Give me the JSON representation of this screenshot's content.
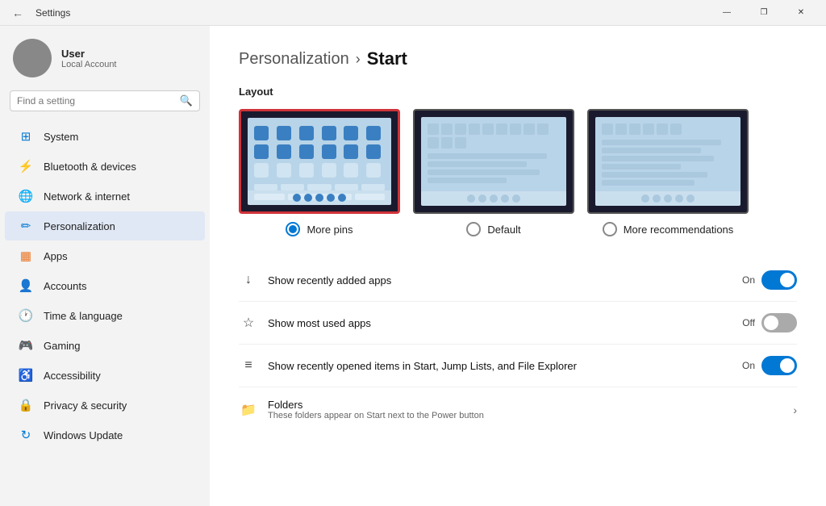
{
  "titlebar": {
    "title": "Settings",
    "minimize_label": "—",
    "maximize_label": "❐",
    "close_label": "✕"
  },
  "sidebar": {
    "search_placeholder": "Find a setting",
    "user": {
      "name": "User",
      "sub": "Local Account"
    },
    "nav_items": [
      {
        "id": "system",
        "label": "System",
        "icon": "⊞",
        "icon_class": "blue"
      },
      {
        "id": "bluetooth",
        "label": "Bluetooth & devices",
        "icon": "⚡",
        "icon_class": "teal"
      },
      {
        "id": "network",
        "label": "Network & internet",
        "icon": "🌐",
        "icon_class": "blue"
      },
      {
        "id": "personalization",
        "label": "Personalization",
        "icon": "✏",
        "icon_class": "blue",
        "active": true
      },
      {
        "id": "apps",
        "label": "Apps",
        "icon": "▦",
        "icon_class": "orange"
      },
      {
        "id": "accounts",
        "label": "Accounts",
        "icon": "👤",
        "icon_class": "blue"
      },
      {
        "id": "time",
        "label": "Time & language",
        "icon": "🕐",
        "icon_class": "purple"
      },
      {
        "id": "gaming",
        "label": "Gaming",
        "icon": "🎮",
        "icon_class": "yellow"
      },
      {
        "id": "accessibility",
        "label": "Accessibility",
        "icon": "♿",
        "icon_class": "darkblue"
      },
      {
        "id": "privacy",
        "label": "Privacy & security",
        "icon": "🔒",
        "icon_class": "green"
      },
      {
        "id": "windows-update",
        "label": "Windows Update",
        "icon": "↻",
        "icon_class": "blue"
      }
    ]
  },
  "content": {
    "breadcrumb_parent": "Personalization",
    "breadcrumb_sep": "›",
    "breadcrumb_current": "Start",
    "layout_label": "Layout",
    "layout_options": [
      {
        "id": "more-pins",
        "label": "More pins",
        "selected": true
      },
      {
        "id": "default",
        "label": "Default",
        "selected": false
      },
      {
        "id": "more-recs",
        "label": "More recommendations",
        "selected": false
      }
    ],
    "settings": [
      {
        "id": "recently-added",
        "title": "Show recently added apps",
        "subtitle": "",
        "toggle_state": "on",
        "toggle_label_on": "On",
        "toggle_label_off": "Off",
        "icon": "↓",
        "type": "toggle"
      },
      {
        "id": "most-used",
        "title": "Show most used apps",
        "subtitle": "",
        "toggle_state": "off",
        "toggle_label_on": "On",
        "toggle_label_off": "Off",
        "icon": "☆",
        "type": "toggle"
      },
      {
        "id": "recently-opened",
        "title": "Show recently opened items in Start, Jump Lists, and File Explorer",
        "subtitle": "",
        "toggle_state": "on",
        "toggle_label_on": "On",
        "toggle_label_off": "Off",
        "icon": "≡",
        "type": "toggle"
      },
      {
        "id": "folders",
        "title": "Folders",
        "subtitle": "These folders appear on Start next to the Power button",
        "icon": "📁",
        "type": "link"
      }
    ]
  }
}
